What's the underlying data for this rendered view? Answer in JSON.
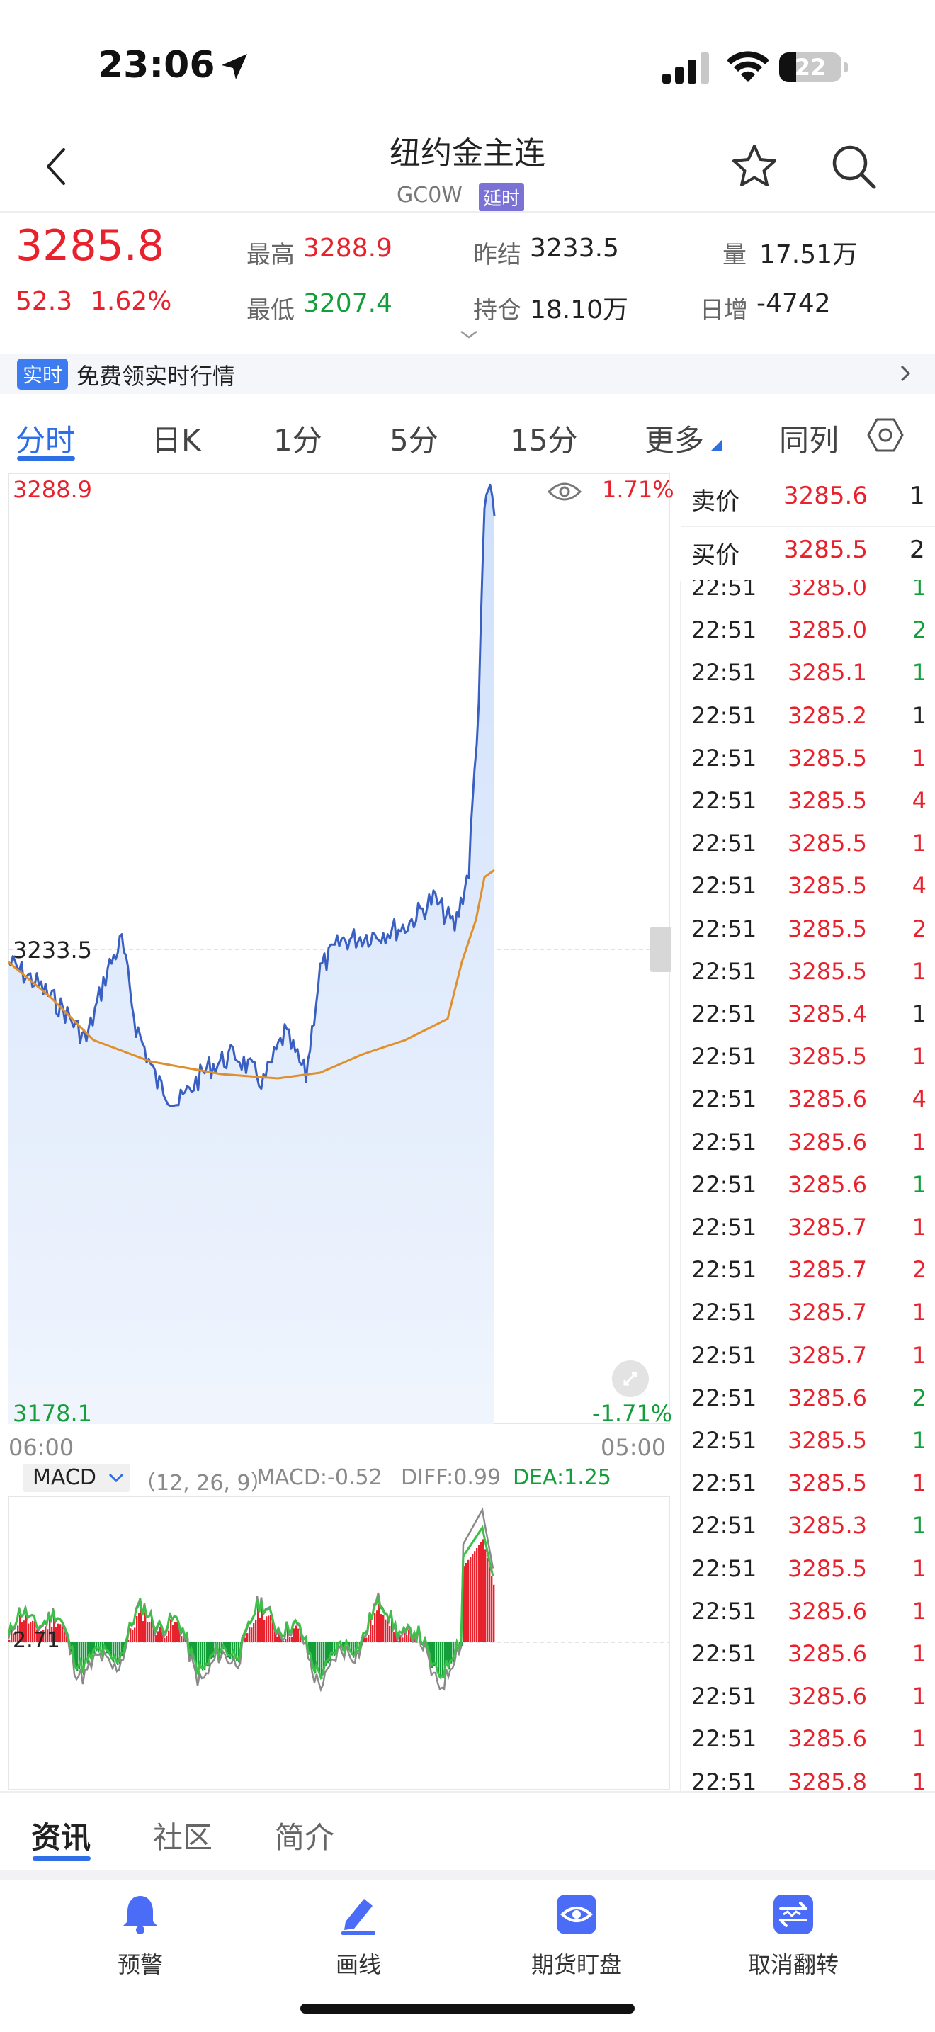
{
  "status_bar": {
    "time": "23:06",
    "battery": "22"
  },
  "header": {
    "title": "纽约金主连",
    "code": "GC0W",
    "delay_badge": "延时"
  },
  "quote": {
    "price": "3285.8",
    "change": "52.3",
    "change_pct": "1.62%",
    "high_label": "最高",
    "high": "3288.9",
    "low_label": "最低",
    "low": "3207.4",
    "prev_settle_label": "昨结",
    "prev_settle": "3233.5",
    "open_interest_label": "持仓",
    "open_interest": "18.10万",
    "volume_label": "量",
    "volume": "17.51万",
    "daily_change_label": "日增",
    "daily_change": "-4742"
  },
  "banner": {
    "badge": "实时",
    "text": "免费领实时行情"
  },
  "tabs": [
    {
      "label": "分时",
      "active": true
    },
    {
      "label": "日K"
    },
    {
      "label": "1分"
    },
    {
      "label": "5分"
    },
    {
      "label": "15分"
    },
    {
      "label": "更多"
    },
    {
      "label": "同列"
    }
  ],
  "chart": {
    "max_label": "3288.9",
    "max_pct": "1.71%",
    "mid_label": "3233.5",
    "min_label": "3178.1",
    "min_pct": "-1.71%",
    "time_start": "06:00",
    "time_end": "05:00"
  },
  "macd": {
    "selector": "MACD",
    "params": "（12, 26, 9）",
    "macd": "MACD:-0.52",
    "diff": "DIFF:0.99",
    "dea": "DEA:1.25",
    "level": "2.71"
  },
  "order_book": {
    "ask_label": "卖价",
    "ask_price": "3285.6",
    "ask_volume": "1",
    "bid_label": "买价",
    "bid_price": "3285.5",
    "bid_volume": "2",
    "trades": [
      {
        "time": "22:51",
        "price": "3285.0",
        "vol": "1",
        "dir": "up"
      },
      {
        "time": "22:51",
        "price": "3285.0",
        "vol": "2",
        "dir": "up"
      },
      {
        "time": "22:51",
        "price": "3285.1",
        "vol": "1",
        "dir": "up"
      },
      {
        "time": "22:51",
        "price": "3285.2",
        "vol": "1",
        "dir": "flat"
      },
      {
        "time": "22:51",
        "price": "3285.5",
        "vol": "1",
        "dir": "down"
      },
      {
        "time": "22:51",
        "price": "3285.5",
        "vol": "4",
        "dir": "down"
      },
      {
        "time": "22:51",
        "price": "3285.5",
        "vol": "1",
        "dir": "down"
      },
      {
        "time": "22:51",
        "price": "3285.5",
        "vol": "4",
        "dir": "down"
      },
      {
        "time": "22:51",
        "price": "3285.5",
        "vol": "2",
        "dir": "down"
      },
      {
        "time": "22:51",
        "price": "3285.5",
        "vol": "1",
        "dir": "down"
      },
      {
        "time": "22:51",
        "price": "3285.4",
        "vol": "1",
        "dir": "flat"
      },
      {
        "time": "22:51",
        "price": "3285.5",
        "vol": "1",
        "dir": "down"
      },
      {
        "time": "22:51",
        "price": "3285.6",
        "vol": "4",
        "dir": "down"
      },
      {
        "time": "22:51",
        "price": "3285.6",
        "vol": "1",
        "dir": "down"
      },
      {
        "time": "22:51",
        "price": "3285.6",
        "vol": "1",
        "dir": "up"
      },
      {
        "time": "22:51",
        "price": "3285.7",
        "vol": "1",
        "dir": "down"
      },
      {
        "time": "22:51",
        "price": "3285.7",
        "vol": "2",
        "dir": "down"
      },
      {
        "time": "22:51",
        "price": "3285.7",
        "vol": "1",
        "dir": "down"
      },
      {
        "time": "22:51",
        "price": "3285.7",
        "vol": "1",
        "dir": "down"
      },
      {
        "time": "22:51",
        "price": "3285.6",
        "vol": "2",
        "dir": "up"
      },
      {
        "time": "22:51",
        "price": "3285.5",
        "vol": "1",
        "dir": "up"
      },
      {
        "time": "22:51",
        "price": "3285.5",
        "vol": "1",
        "dir": "down"
      },
      {
        "time": "22:51",
        "price": "3285.3",
        "vol": "1",
        "dir": "up"
      },
      {
        "time": "22:51",
        "price": "3285.5",
        "vol": "1",
        "dir": "down"
      },
      {
        "time": "22:51",
        "price": "3285.6",
        "vol": "1",
        "dir": "down"
      },
      {
        "time": "22:51",
        "price": "3285.6",
        "vol": "1",
        "dir": "down"
      },
      {
        "time": "22:51",
        "price": "3285.6",
        "vol": "1",
        "dir": "down"
      },
      {
        "time": "22:51",
        "price": "3285.6",
        "vol": "1",
        "dir": "down"
      },
      {
        "time": "22:51",
        "price": "3285.8",
        "vol": "1",
        "dir": "down"
      }
    ]
  },
  "info_tabs": [
    {
      "label": "资讯",
      "active": true
    },
    {
      "label": "社区"
    },
    {
      "label": "简介"
    }
  ],
  "bottom_nav": [
    {
      "label": "预警",
      "icon": "bell-icon"
    },
    {
      "label": "画线",
      "icon": "pen-icon"
    },
    {
      "label": "期货盯盘",
      "icon": "eye-icon"
    },
    {
      "label": "取消翻转",
      "icon": "flip-icon"
    }
  ],
  "colors": {
    "up": "#e8222d",
    "down": "#139e3a",
    "accent": "#2f6fe6",
    "price_line": "#3a5fc2",
    "avg_line": "#e0902a"
  }
}
